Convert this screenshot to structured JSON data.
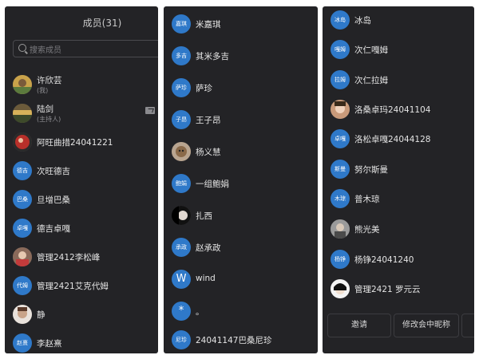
{
  "header": {
    "title": "成员(31)"
  },
  "search": {
    "placeholder": "搜索成员"
  },
  "panel1": [
    {
      "name": "许欣芸",
      "sub": "(我)",
      "avatar": "photo"
    },
    {
      "name": "陆剑",
      "sub": "(主持人)",
      "avatar": "photo"
    },
    {
      "name": "阿旺曲措24041221",
      "avatar": "photo"
    },
    {
      "name": "次旺德吉",
      "avatar_text": "德吉"
    },
    {
      "name": "旦增巴桑",
      "avatar_text": "巴桑"
    },
    {
      "name": "德吉卓嘎",
      "avatar_text": "卓嘎"
    },
    {
      "name": "管理2412李松峰",
      "avatar": "photo"
    },
    {
      "name": "管理2421艾克代姆",
      "avatar_text": "代姆"
    },
    {
      "name": "静",
      "avatar": "photo"
    },
    {
      "name": "李赵熹",
      "avatar_text": "赵熹"
    }
  ],
  "panel2": [
    {
      "name": "米嘉琪",
      "avatar_text": "嘉琪"
    },
    {
      "name": "其米多吉",
      "avatar_text": "多吉"
    },
    {
      "name": "萨珍",
      "avatar_text": "萨珍"
    },
    {
      "name": "王子昂",
      "avatar_text": "子昂"
    },
    {
      "name": "杨义慧",
      "avatar": "photo"
    },
    {
      "name": "一组鲍娟",
      "avatar_text": "鲍娟"
    },
    {
      "name": "扎西",
      "avatar": "photo"
    },
    {
      "name": "赵承政",
      "avatar_text": "承政"
    },
    {
      "name": "wind",
      "avatar_text": "W"
    },
    {
      "name": "。",
      "avatar_text": "*"
    },
    {
      "name": "24041147巴桑尼珍",
      "avatar_text": "尼珍"
    }
  ],
  "panel3": [
    {
      "name": "冰岛",
      "avatar_text": "冰岛"
    },
    {
      "name": "次仁嘎姆",
      "avatar_text": "嘎姆"
    },
    {
      "name": "次仁拉姆",
      "avatar_text": "拉姆"
    },
    {
      "name": "洛桑卓玛24041104",
      "avatar": "photo"
    },
    {
      "name": "洛松卓嘎24044128",
      "avatar_text": "卓嘎"
    },
    {
      "name": "努尔斯曼",
      "avatar_text": "斯曼"
    },
    {
      "name": "普木琼",
      "avatar_text": "木琼"
    },
    {
      "name": "熊光美",
      "avatar": "photo"
    },
    {
      "name": "杨铮24041240",
      "avatar_text": "杨铮"
    },
    {
      "name": "管理2421 罗元云",
      "avatar": "photo"
    }
  ],
  "buttons": {
    "invite": "邀请",
    "rename": "修改会中昵称"
  },
  "colors": {
    "panel_bg": "#232326",
    "avatar_blue": "#2f79c9",
    "text": "#e4e4e4"
  }
}
